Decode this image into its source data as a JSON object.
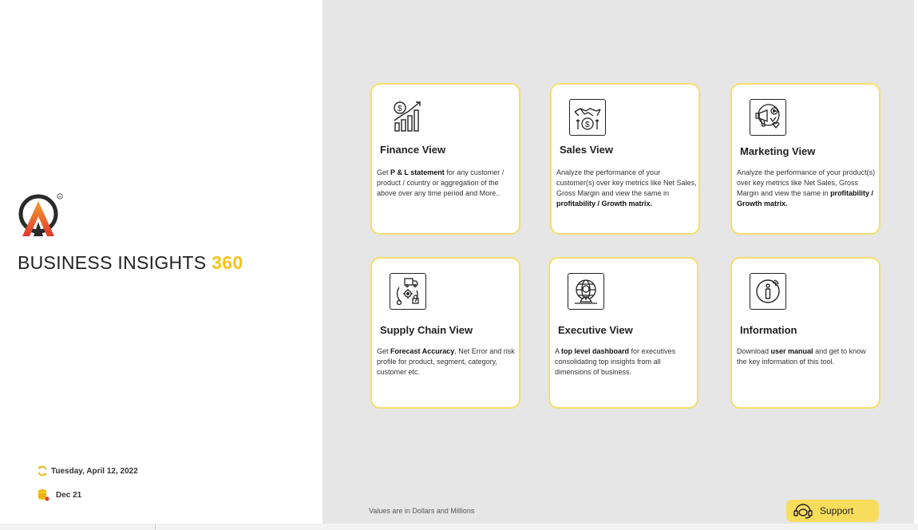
{
  "brand": {
    "title": "BUSINESS INSIGHTS",
    "accent": "360",
    "accent_color": "#f5c518"
  },
  "meta": {
    "refresh_date": "Tuesday, April 12, 2022",
    "data_period": "Dec 21"
  },
  "cards": [
    {
      "title": "Finance View",
      "icon": "finance-growth-icon",
      "desc": [
        {
          "t": "Get  ",
          "b": false
        },
        {
          "t": "P & L statement",
          "b": true
        },
        {
          "t": " for any customer / product / country or aggregation of the above over any time period and More..",
          "b": false
        }
      ]
    },
    {
      "title": "Sales View",
      "icon": "handshake-dollar-icon",
      "desc": [
        {
          "t": "Analyze the performance of your customer(s) over key metrics like Net Sales, Gross Margin and view the same in ",
          "b": false
        },
        {
          "t": "profitability / Growth matrix.",
          "b": true
        }
      ]
    },
    {
      "title": "Marketing View",
      "icon": "marketing-megaphone-icon",
      "desc": [
        {
          "t": "Analyze the performance of your product(s) over key metrics like Net Sales, Gross Margin and view the same in ",
          "b": false
        },
        {
          "t": "profitability / Growth matrix.",
          "b": true
        }
      ]
    },
    {
      "title": "Supply Chain View",
      "icon": "supply-chain-icon",
      "desc": [
        {
          "t": "Get ",
          "b": false
        },
        {
          "t": "Forecast Accuracy",
          "b": true
        },
        {
          "t": ", Net Error and risk profile for product, segment, category, customer etc.",
          "b": false
        }
      ]
    },
    {
      "title": "Executive View",
      "icon": "executive-globe-icon",
      "desc": [
        {
          "t": "A ",
          "b": false
        },
        {
          "t": "top level dashboard",
          "b": true
        },
        {
          "t": " for executives consolidating top insights from all dimensions of business.",
          "b": false
        }
      ]
    },
    {
      "title": "Information",
      "icon": "information-icon",
      "desc": [
        {
          "t": "Download ",
          "b": false
        },
        {
          "t": "user manual",
          "b": true
        },
        {
          "t": " and get to know the key information of this tool.",
          "b": false
        }
      ]
    }
  ],
  "footnote": "Values are in Dollars and Millions",
  "support": {
    "label": "Support",
    "icon": "support-headset-icon"
  }
}
